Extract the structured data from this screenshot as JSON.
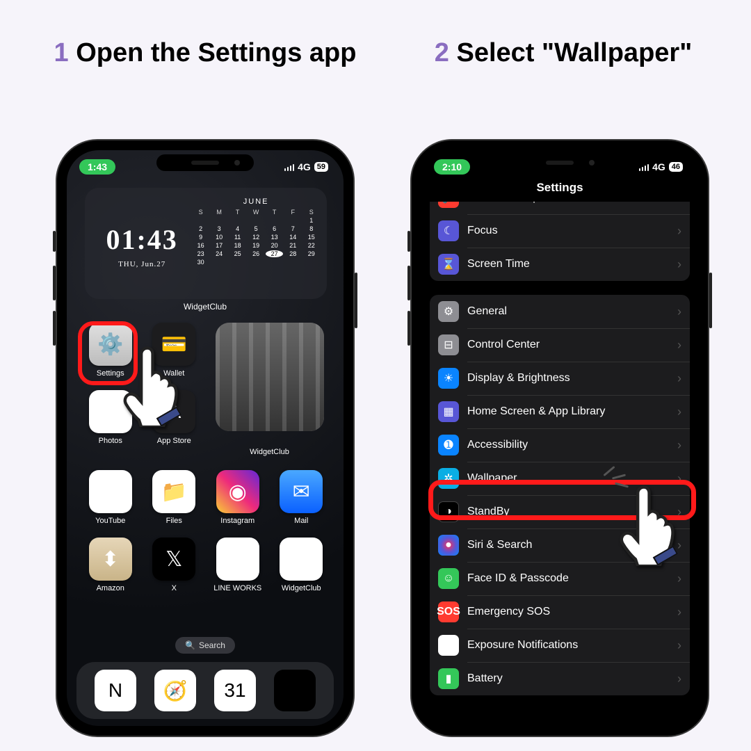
{
  "colors": {
    "accent": "#8a6dc0",
    "highlight": "#ff1a1a",
    "ios_green": "#34c759"
  },
  "steps": [
    {
      "num": "1",
      "pre": "Open ",
      "bold": "the Settings app"
    },
    {
      "num": "2",
      "pre": "Select ",
      "bold": "\"Wallpaper\""
    }
  ],
  "left": {
    "status": {
      "time": "1:43",
      "network": "4G",
      "battery": "59"
    },
    "clock_widget": {
      "time": "01:43",
      "date": "THU, Jun.27",
      "month": "JUNE",
      "dow": [
        "S",
        "M",
        "T",
        "W",
        "T",
        "F",
        "S"
      ],
      "days": [
        "",
        "",
        "",
        "",
        "",
        "",
        "1",
        "2",
        "3",
        "4",
        "5",
        "6",
        "7",
        "8",
        "9",
        "10",
        "11",
        "12",
        "13",
        "14",
        "15",
        "16",
        "17",
        "18",
        "19",
        "20",
        "21",
        "22",
        "23",
        "24",
        "25",
        "26",
        "27",
        "28",
        "29",
        "30"
      ],
      "today": "27",
      "label": "WidgetClub"
    },
    "apps_row": [
      {
        "key": "settings",
        "label": "Settings"
      },
      {
        "key": "wallet",
        "label": "Wallet"
      },
      {
        "key": "photos",
        "label": "Photos"
      },
      {
        "key": "appstore",
        "label": "App Store"
      },
      {
        "key": "youtube",
        "label": "YouTube"
      },
      {
        "key": "files",
        "label": "Files"
      },
      {
        "key": "instagram",
        "label": "Instagram"
      },
      {
        "key": "mail",
        "label": "Mail"
      },
      {
        "key": "amazon",
        "label": "Amazon"
      },
      {
        "key": "x",
        "label": "X"
      },
      {
        "key": "lineworks",
        "label": "LINE WORKS"
      },
      {
        "key": "widgetclub",
        "label": "WidgetClub"
      }
    ],
    "photo_widget_label": "WidgetClub",
    "search_label": "Search",
    "dock": [
      "notion",
      "safari",
      "gcal",
      "chatgpt"
    ]
  },
  "right": {
    "status": {
      "time": "2:10",
      "network": "4G",
      "battery": "46"
    },
    "title": "Settings",
    "group1": [
      {
        "ic": "sounds",
        "label": "Sounds & Haptics"
      },
      {
        "ic": "focus",
        "label": "Focus"
      },
      {
        "ic": "screentime",
        "label": "Screen Time"
      }
    ],
    "group2": [
      {
        "ic": "general",
        "label": "General"
      },
      {
        "ic": "cc",
        "label": "Control Center"
      },
      {
        "ic": "display",
        "label": "Display & Brightness"
      },
      {
        "ic": "home",
        "label": "Home Screen & App Library"
      },
      {
        "ic": "access",
        "label": "Accessibility"
      },
      {
        "ic": "wall",
        "label": "Wallpaper"
      },
      {
        "ic": "standby",
        "label": "StandBy"
      },
      {
        "ic": "siri",
        "label": "Siri & Search"
      },
      {
        "ic": "faceid",
        "label": "Face ID & Passcode"
      },
      {
        "ic": "sos",
        "label": "Emergency SOS"
      },
      {
        "ic": "exposure",
        "label": "Exposure Notifications"
      },
      {
        "ic": "battery",
        "label": "Battery"
      }
    ]
  }
}
